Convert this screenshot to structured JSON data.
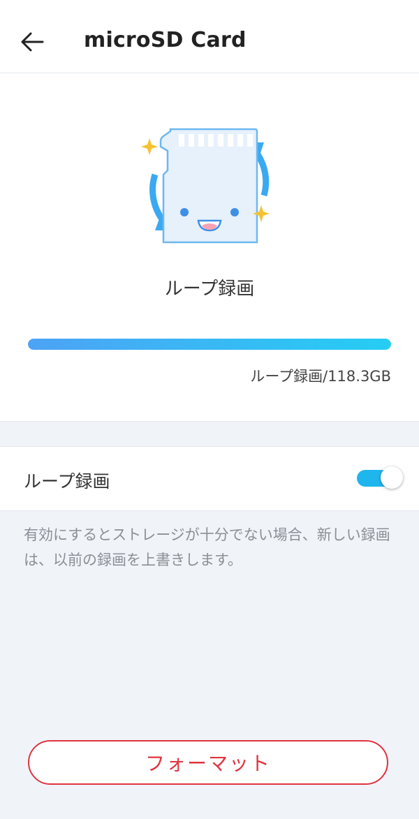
{
  "header": {
    "title": "microSD Card",
    "back_icon": "arrow-left-icon"
  },
  "storage": {
    "mode_label": "ループ録画",
    "usage_text": "ループ録画/118.3GB",
    "progress_fraction": 1.0
  },
  "loop_recording": {
    "label": "ループ録画",
    "enabled": true,
    "description": "有効にするとストレージが十分でない場合、新しい録画は、以前の録画を上書きします。"
  },
  "actions": {
    "format_label": "フォーマット"
  },
  "colors": {
    "accent": "#1fb6ee",
    "danger": "#e0343f",
    "background": "#f0f4f9"
  }
}
